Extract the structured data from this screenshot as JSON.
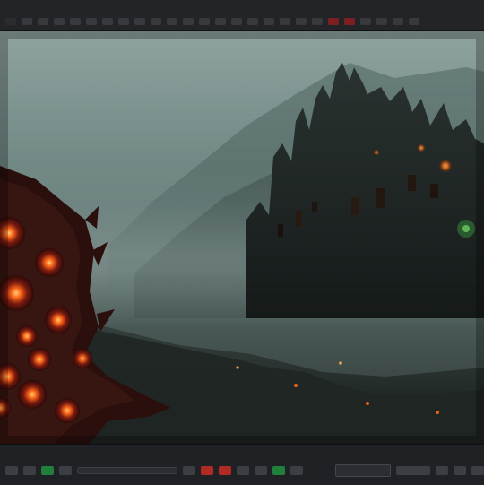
{
  "app": {
    "title": ""
  },
  "viewer": {
    "image_name": "fantasy-fortress-render"
  },
  "colors": {
    "toolbar": "#232427",
    "accent_red": "#b12a23",
    "accent_green": "#1f7f3b",
    "bg": "#1b1c1e"
  },
  "icons": {
    "top": [
      "top-tool-1",
      "top-tool-2",
      "top-tool-3",
      "top-tool-4",
      "top-tool-5",
      "top-tool-6",
      "top-tool-7",
      "top-tool-8",
      "top-tool-9",
      "top-tool-10",
      "top-tool-11",
      "top-tool-12",
      "top-tool-13",
      "top-tool-14",
      "top-tool-15",
      "top-tool-16",
      "top-tool-17",
      "top-tool-18",
      "top-tool-19",
      "top-tool-20",
      "top-tool-21",
      "top-tool-22",
      "top-tool-23",
      "top-tool-24",
      "top-tool-25",
      "top-tool-26"
    ],
    "bottom": [
      "record-icon",
      "stop-icon",
      "play-icon",
      "pause-icon",
      "timeline-slider",
      "playhead-icon",
      "loop-icon",
      "green-status-icon",
      "red-status-icon",
      "panel-meter",
      "zoom-in-icon",
      "zoom-out-icon",
      "fit-icon",
      "settings-icon"
    ]
  }
}
